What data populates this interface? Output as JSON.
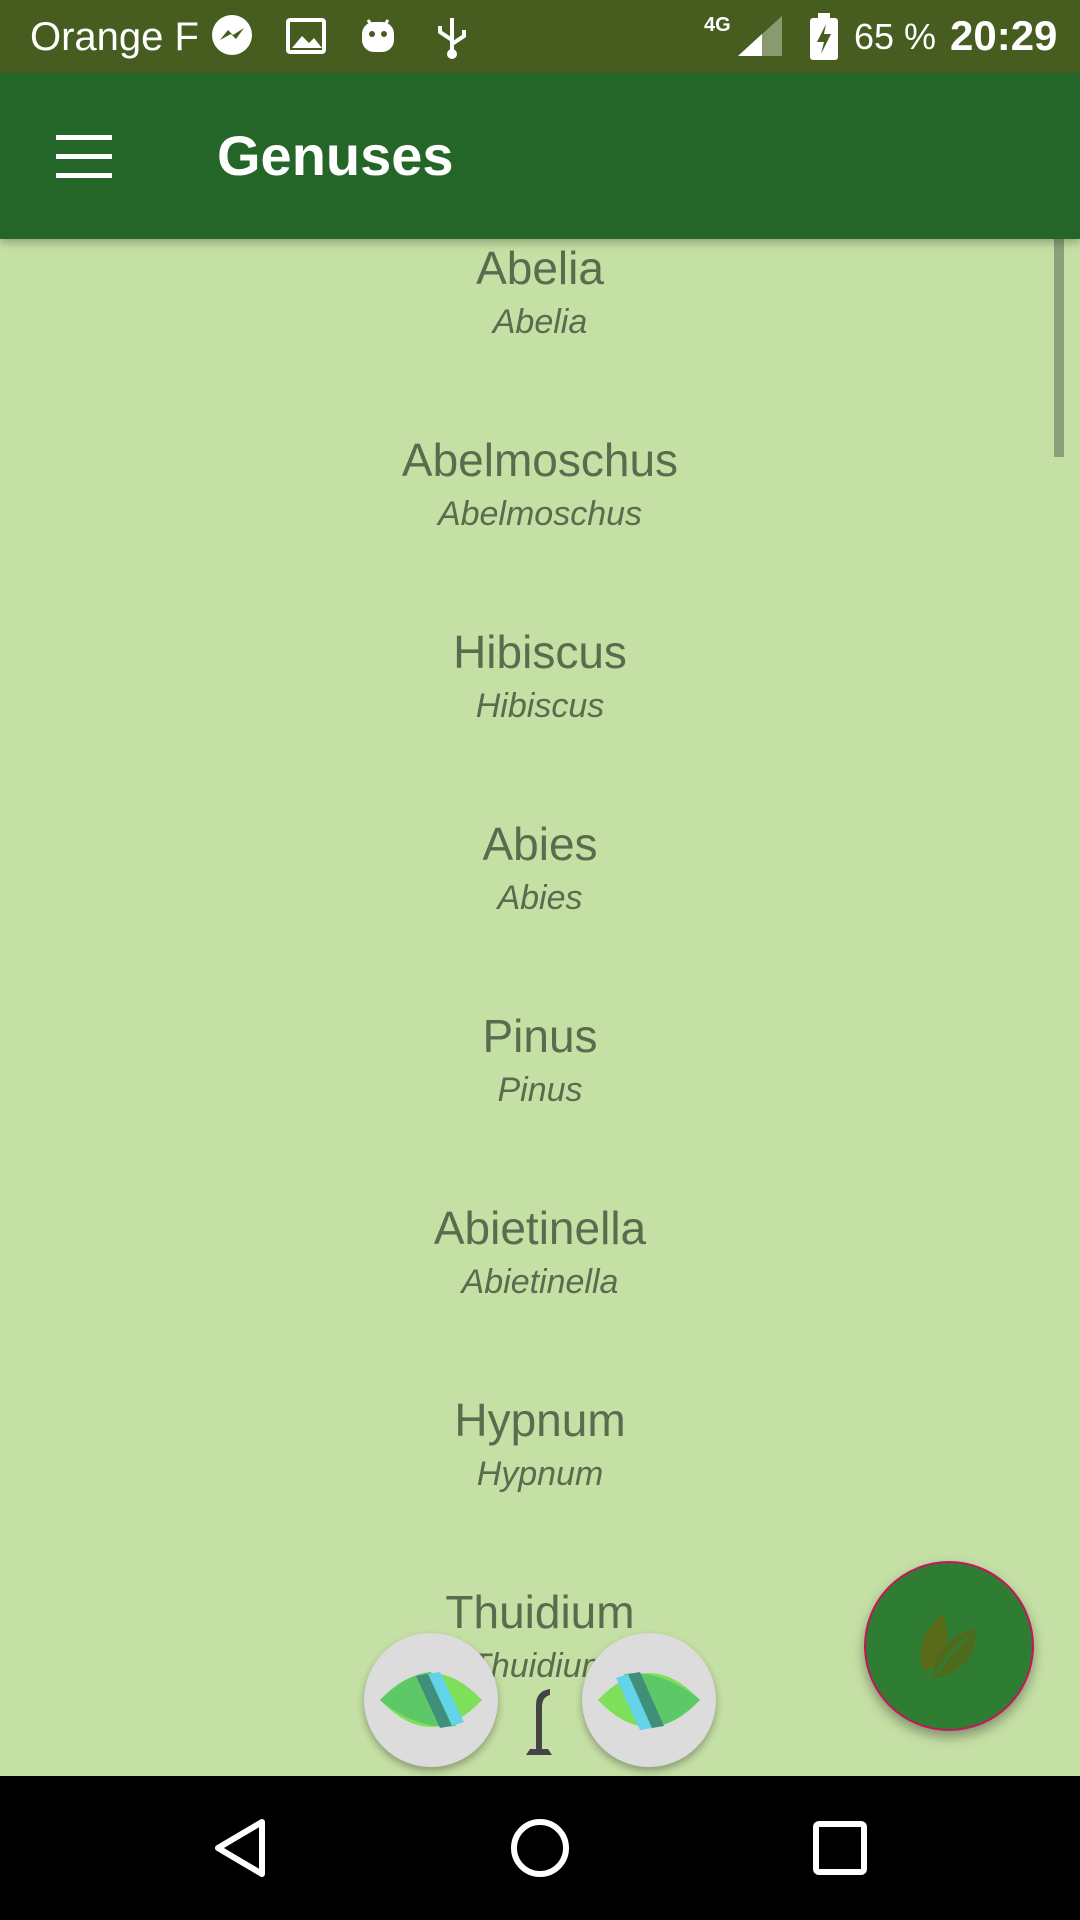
{
  "status_bar": {
    "carrier": "Orange F",
    "network": "4G",
    "battery": "65 %",
    "time": "20:29",
    "icons": [
      "messenger-icon",
      "image-icon",
      "android-icon",
      "usb-icon",
      "signal-icon",
      "battery-charging-icon"
    ]
  },
  "app_bar": {
    "title": "Genuses",
    "menu_icon": "hamburger-menu-icon"
  },
  "list": {
    "items": [
      {
        "name": "Abelia",
        "latin": "Abelia"
      },
      {
        "name": "Abelmoschus",
        "latin": "Abelmoschus"
      },
      {
        "name": "Hibiscus",
        "latin": "Hibiscus"
      },
      {
        "name": "Abies",
        "latin": "Abies"
      },
      {
        "name": "Pinus",
        "latin": "Pinus"
      },
      {
        "name": "Abietinella",
        "latin": "Abietinella"
      },
      {
        "name": "Hypnum",
        "latin": "Hypnum"
      },
      {
        "name": "Thuidium",
        "latin": "Thuidium"
      }
    ]
  },
  "fab": {
    "icon": "leaves-icon"
  },
  "bottom_controls": {
    "left_icon": "leaf-icon",
    "center_icon": "tree-icon",
    "right_icon": "leaf-icon"
  },
  "nav_bar": {
    "icons": [
      "back-icon",
      "home-icon",
      "recents-icon"
    ]
  },
  "colors": {
    "status_bar": "#475d20",
    "app_bar": "#246628",
    "background": "#c5e0a5",
    "text": "#5b6b4e",
    "fab": "#2e7d32"
  }
}
